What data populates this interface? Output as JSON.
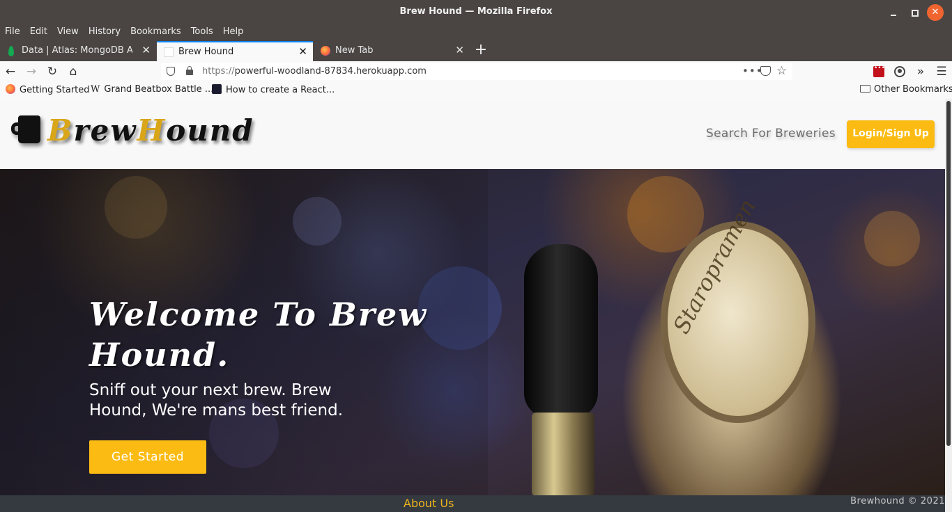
{
  "window": {
    "title": "Brew Hound — Mozilla Firefox"
  },
  "menu": [
    "File",
    "Edit",
    "View",
    "History",
    "Bookmarks",
    "Tools",
    "Help"
  ],
  "tabs": [
    {
      "label": "Data | Atlas: MongoDB Atlas",
      "icon": "mongodb-leaf-icon",
      "active": false
    },
    {
      "label": "Brew Hound",
      "icon": "blank-page-icon",
      "active": true
    },
    {
      "label": "New Tab",
      "icon": "firefox-icon",
      "active": false
    }
  ],
  "url": {
    "scheme": "https://",
    "host": "powerful-woodland-87834.herokuapp.com"
  },
  "bookmarks": [
    {
      "label": "Getting Started",
      "icon": "firefox-icon"
    },
    {
      "label": "Grand Beatbox Battle ...",
      "icon": "wikipedia-icon"
    },
    {
      "label": "How to create a React...",
      "icon": "react-icon"
    }
  ],
  "bookmarks_other": "Other Bookmarks",
  "site": {
    "logo_text_1": "B",
    "logo_text_2": "rew",
    "logo_text_3": "H",
    "logo_text_4": "ound",
    "search_link": "Search For Breweries",
    "login_button": "Login/Sign Up"
  },
  "hero": {
    "title": "Welcome To Brew Hound.",
    "subtitle": "Sniff out your next brew. Brew Hound, We're mans best friend.",
    "cta": "Get Started",
    "tap_brand": "Staropramen"
  },
  "footer": {
    "link": "About Us",
    "copyright": "Brewhound © 2021"
  },
  "colors": {
    "accent": "#fbbb12",
    "footer_bg": "#343a40",
    "titlebar_bg": "#4a4543"
  }
}
